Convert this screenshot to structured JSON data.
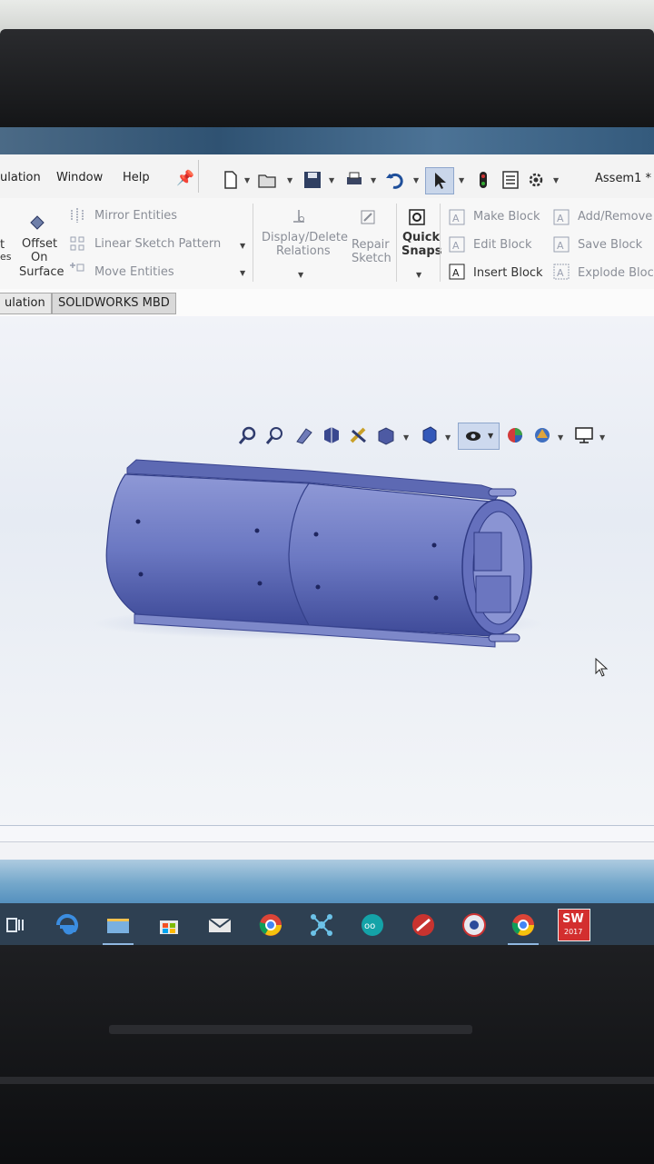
{
  "menubar": {
    "items": [
      "ulation",
      "Window",
      "Help"
    ],
    "document_title": "Assem1 *"
  },
  "ribbon": {
    "offset_on_surface": [
      "Offset",
      "On",
      "Surface"
    ],
    "left_cut": [
      "t",
      "es"
    ],
    "mirror_entities": "Mirror Entities",
    "linear_sketch_pattern": "Linear Sketch Pattern",
    "move_entities": "Move Entities",
    "display_delete_relations": [
      "Display/Delete",
      "Relations"
    ],
    "repair_sketch": [
      "Repair",
      "Sketch"
    ],
    "quick_snaps": [
      "Quick",
      "Snaps"
    ],
    "make_block": "Make Block",
    "edit_block": "Edit Block",
    "insert_block": "Insert Block",
    "add_remove": "Add/Remove",
    "save_block": "Save Block",
    "explode_block": "Explode Block"
  },
  "tabs": [
    "ulation",
    "SOLIDWORKS MBD"
  ],
  "taskbar": {
    "apps": [
      "task-view",
      "edge",
      "file-explorer",
      "store",
      "mail",
      "chrome",
      "network-app",
      "arduino",
      "red-app",
      "badge-app",
      "chrome-2",
      "solidworks-2017"
    ],
    "solidworks_badge": "SW",
    "solidworks_year": "2017"
  },
  "colors": {
    "model_face": "#6b78c2",
    "model_dark": "#3b4591",
    "taskbar": "#2e4052",
    "accent": "#1e5aa8"
  }
}
